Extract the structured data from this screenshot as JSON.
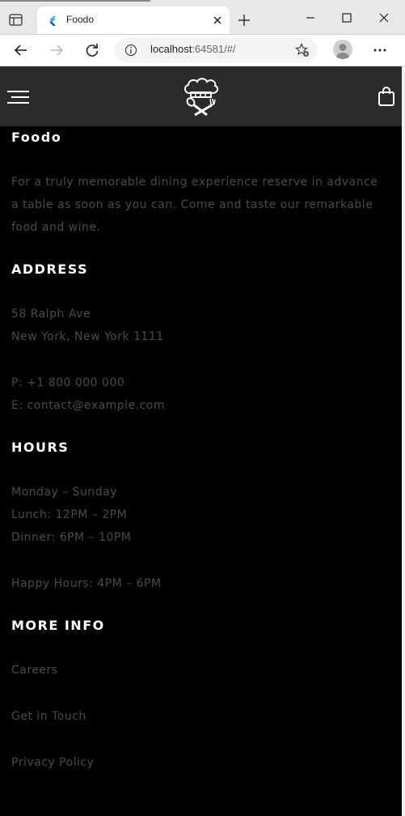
{
  "browser": {
    "tab_title": "Foodo",
    "url_host": "localhost",
    "url_rest": ":64581/#/",
    "accent": "#1a73e8"
  },
  "header": {
    "background": "#2b2b2b",
    "icons": [
      "menu-icon",
      "chef-logo-icon",
      "shopping-bag-icon"
    ]
  },
  "footer": {
    "brand": {
      "title": "Foodo",
      "description": "For a truly memorable dining experience reserve in advance a table as soon as you can. Come and taste our remarkable food and wine."
    },
    "address": {
      "title": "ADDRESS",
      "street": "58 Ralph Ave",
      "city": "New York, New York 1111",
      "phone": "P: +1 800 000 000",
      "email": "E: contact@example.com"
    },
    "hours": {
      "title": "HOURS",
      "days": "Monday – Sunday",
      "lunch": "Lunch: 12PM – 2PM",
      "dinner": "Dinner: 6PM – 10PM",
      "happy": "Happy Hours: 4PM – 6PM"
    },
    "more_info": {
      "title": "MORE INFO",
      "links": [
        "Careers",
        "Get in Touch",
        "Privacy Policy"
      ]
    }
  }
}
